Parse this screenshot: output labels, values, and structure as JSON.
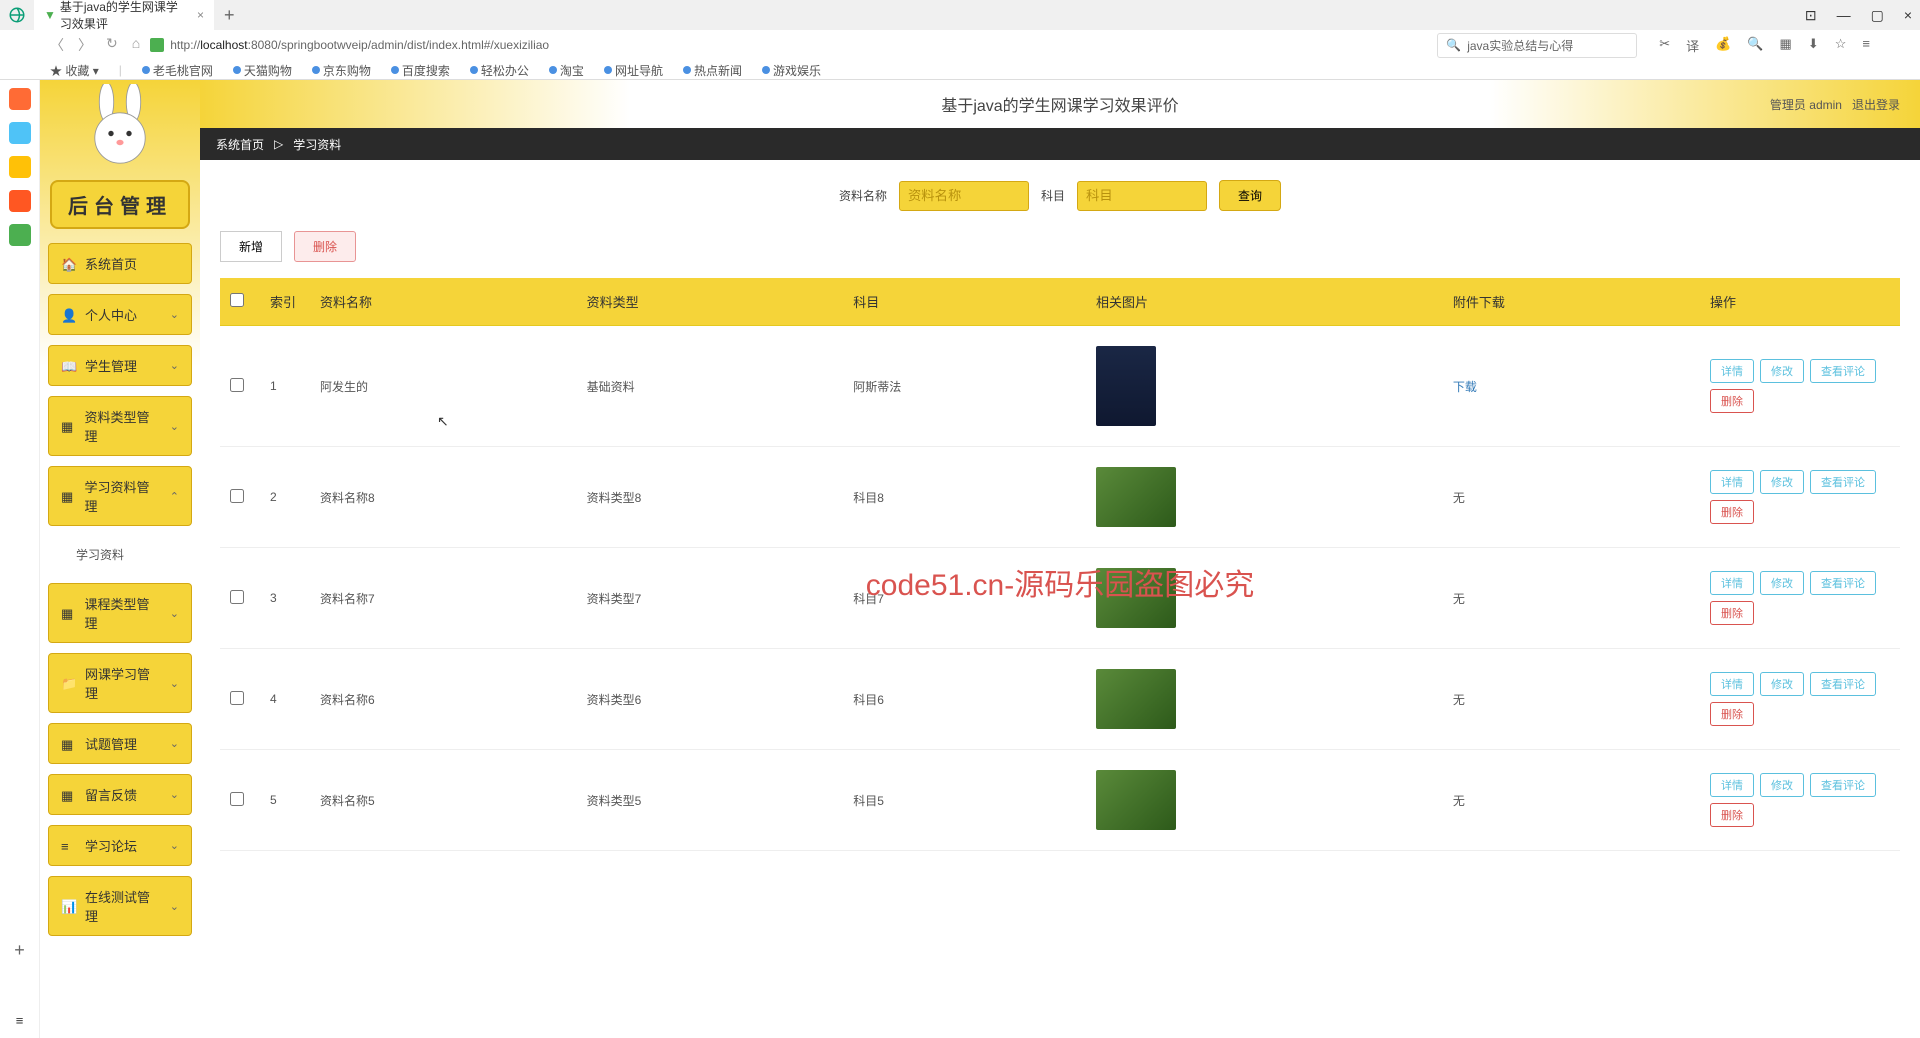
{
  "browser": {
    "tab_title": "基于java的学生网课学习效果评",
    "url_prefix": "http://",
    "url_host": "localhost",
    "url_path": ":8080/springbootwveip/admin/dist/index.html#/xuexiziliao",
    "search_query": "java实验总结与心得",
    "bookmarks_label": "收藏",
    "bookmarks": [
      "老毛桃官网",
      "天猫购物",
      "京东购物",
      "百度搜索",
      "轻松办公",
      "淘宝",
      "网址导航",
      "热点新闻",
      "游戏娱乐"
    ]
  },
  "banner": {
    "title": "基于java的学生网课学习效果评价",
    "admin_label": "管理员",
    "admin_name": "admin",
    "logout": "退出登录"
  },
  "sidebar": {
    "title": "后台管理",
    "items": [
      {
        "label": "系统首页"
      },
      {
        "label": "个人中心"
      },
      {
        "label": "学生管理"
      },
      {
        "label": "资料类型管理"
      },
      {
        "label": "学习资料管理",
        "expanded": true,
        "children": [
          {
            "label": "学习资料"
          }
        ]
      },
      {
        "label": "课程类型管理"
      },
      {
        "label": "网课学习管理"
      },
      {
        "label": "试题管理"
      },
      {
        "label": "留言反馈"
      },
      {
        "label": "学习论坛"
      },
      {
        "label": "在线测试管理"
      }
    ]
  },
  "breadcrumb": {
    "home": "系统首页",
    "sep": "▷",
    "current": "学习资料"
  },
  "filters": {
    "name_label": "资料名称",
    "name_placeholder": "资料名称",
    "subject_label": "科目",
    "subject_placeholder": "科目",
    "query": "查询"
  },
  "actions": {
    "add": "新增",
    "delete": "删除"
  },
  "table": {
    "headers": {
      "index": "索引",
      "name": "资料名称",
      "type": "资料类型",
      "subject": "科目",
      "image": "相关图片",
      "download": "附件下载",
      "operate": "操作"
    },
    "row_actions": {
      "detail": "详情",
      "edit": "修改",
      "comment": "查看评论",
      "delete": "删除"
    },
    "download_link": "下载",
    "none": "无",
    "rows": [
      {
        "idx": "1",
        "name": "阿发生的",
        "type": "基础资料",
        "subject": "阿斯蒂法",
        "has_dl": true,
        "img": "book"
      },
      {
        "idx": "2",
        "name": "资料名称8",
        "type": "资料类型8",
        "subject": "科目8",
        "has_dl": false,
        "img": "photo"
      },
      {
        "idx": "3",
        "name": "资料名称7",
        "type": "资料类型7",
        "subject": "科目7",
        "has_dl": false,
        "img": "photo"
      },
      {
        "idx": "4",
        "name": "资料名称6",
        "type": "资料类型6",
        "subject": "科目6",
        "has_dl": false,
        "img": "photo"
      },
      {
        "idx": "5",
        "name": "资料名称5",
        "type": "资料类型5",
        "subject": "科目5",
        "has_dl": false,
        "img": "photo"
      }
    ]
  },
  "watermark": "code51.cn",
  "watermark_big": "code51.cn-源码乐园盗图必究"
}
